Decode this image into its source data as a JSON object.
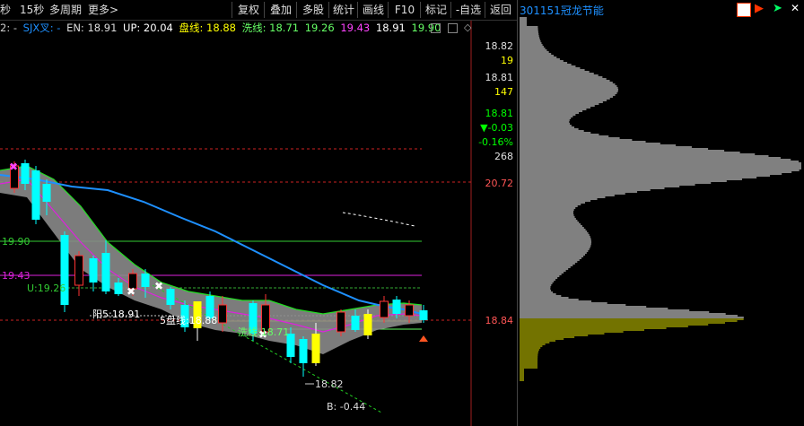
{
  "toolbar": {
    "items": [
      "秒",
      "15秒",
      "多周期",
      "更多>"
    ],
    "buttons": [
      "复权",
      "叠加",
      "多股",
      "统计",
      "画线",
      "F10",
      "标记",
      "-自选",
      "返回"
    ]
  },
  "stock": {
    "code": "301151",
    "name": "冠龙节能"
  },
  "indicator": {
    "prefix": "2: -",
    "name": "SJX叉: -",
    "en": "EN: 18.91",
    "up": "UP: 20.04",
    "pan": "盘线: 18.88",
    "xi": "洗线: 18.71",
    "v1": "19.26",
    "v2": "19.43",
    "v3": "18.91",
    "v4": "19.90"
  },
  "axis": {
    "labels": [
      {
        "text": "18.82",
        "color": "#e0e0e0"
      },
      {
        "text": "19",
        "color": "#ffff00"
      },
      {
        "text": "18.81",
        "color": "#e0e0e0"
      },
      {
        "text": "147",
        "color": "#ffff00"
      },
      {
        "text": "18.81",
        "color": "#00ff00"
      },
      {
        "text": "▼-0.03",
        "color": "#00ff00"
      },
      {
        "text": "-0.16%",
        "color": "#00ff00"
      },
      {
        "text": "268",
        "color": "#e0e0e0"
      },
      {
        "text": "20.72",
        "color": "#ff5555"
      },
      {
        "text": "18.84",
        "color": "#ff5555"
      }
    ]
  },
  "annotations": {
    "level_1990": "19.90",
    "level_1943": "19.43",
    "u_line": "U:19.26",
    "yang": "阳5:18.91",
    "pan5": "5盘线:18.88",
    "xi_line": "洗线:18.71",
    "low": "18.82",
    "b_val": "B: -0.44"
  },
  "colors": {
    "up": "#ff3333",
    "down": "#00ffff",
    "yellow": "#ffff00",
    "ma": "#1e90ff",
    "green": "#00ff00",
    "magenta": "#ff00ff"
  }
}
